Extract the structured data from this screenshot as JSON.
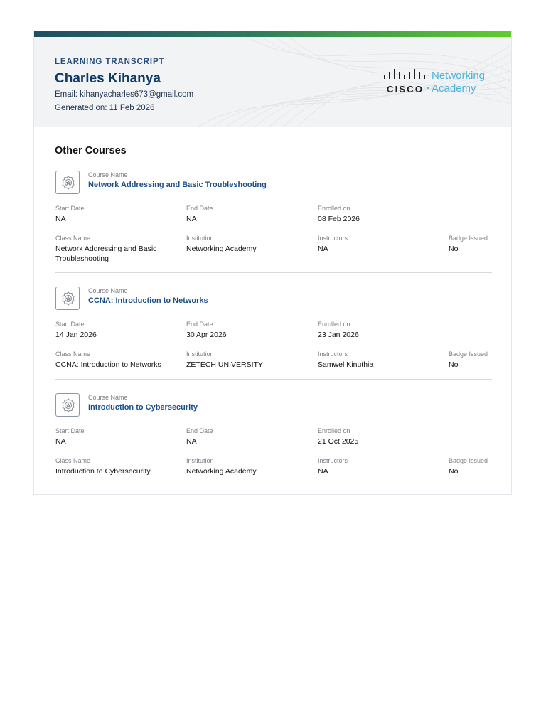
{
  "header": {
    "kicker": "LEARNING TRANSCRIPT",
    "name": "Charles Kihanya",
    "email": "Email: kihanyacharles673@gmail.com",
    "generated": "Generated on: 11 Feb 2026",
    "logo": {
      "brand": "CISCO",
      "line1": "Networking",
      "line2": "Academy",
      "icon": "cisco-bars-icon"
    }
  },
  "colors": {
    "accent_blue": "#1b4f8a",
    "gradient_start": "#1f4e63",
    "gradient_end": "#5fcd2c",
    "logo_blue": "#4fb3d9"
  },
  "section_title": "Other Courses",
  "labels": {
    "course_name": "Course Name",
    "start_date": "Start Date",
    "end_date": "End Date",
    "enrolled_on": "Enrolled on",
    "class_name": "Class Name",
    "institution": "Institution",
    "instructors": "Instructors",
    "badge_issued": "Badge Issued"
  },
  "courses": [
    {
      "icon": "badge-award-icon",
      "title": "Network Addressing and Basic Troubleshooting",
      "start_date": "NA",
      "end_date": "NA",
      "enrolled_on": "08 Feb 2026",
      "class_name": "Network Addressing and Basic Troubleshooting",
      "institution": "Networking Academy",
      "instructors": "NA",
      "badge_issued": "No"
    },
    {
      "icon": "badge-award-icon",
      "title": "CCNA: Introduction to Networks",
      "start_date": "14 Jan 2026",
      "end_date": "30 Apr 2026",
      "enrolled_on": "23 Jan 2026",
      "class_name": "CCNA: Introduction to Networks",
      "institution": "ZETECH UNIVERSITY",
      "instructors": "Samwel Kinuthia",
      "badge_issued": "No"
    },
    {
      "icon": "badge-award-icon",
      "title": "Introduction to Cybersecurity",
      "start_date": "NA",
      "end_date": "NA",
      "enrolled_on": "21 Oct 2025",
      "class_name": "Introduction to Cybersecurity",
      "institution": "Networking Academy",
      "instructors": "NA",
      "badge_issued": "No"
    }
  ]
}
